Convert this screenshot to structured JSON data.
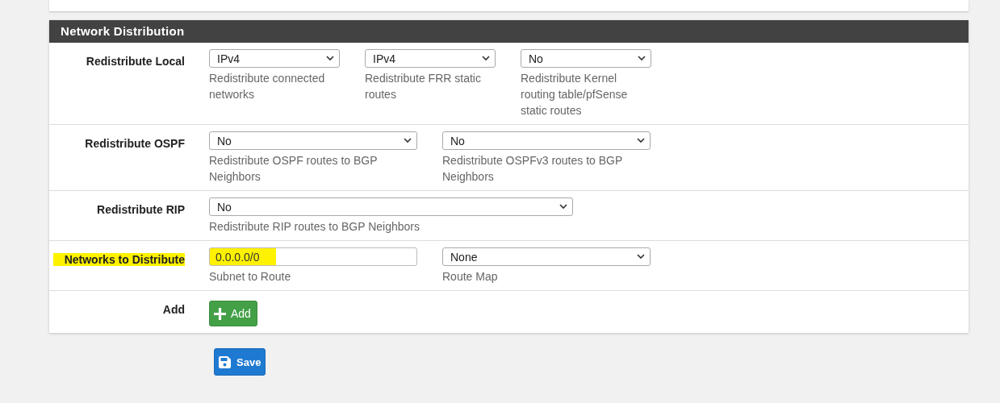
{
  "panel": {
    "title": "Network Distribution",
    "rows": [
      {
        "label": "Redistribute Local",
        "highlighted": false,
        "fields": [
          {
            "kind": "select",
            "value": "IPv4",
            "help": "Redistribute connected networks"
          },
          {
            "kind": "select",
            "value": "IPv4",
            "help": "Redistribute FRR static routes"
          },
          {
            "kind": "select",
            "value": "No",
            "help": "Redistribute Kernel routing table/pfSense static routes"
          }
        ]
      },
      {
        "label": "Redistribute OSPF",
        "highlighted": false,
        "fields": [
          {
            "kind": "select",
            "value": "No",
            "help": "Redistribute OSPF routes to BGP Neighbors"
          },
          {
            "kind": "select",
            "value": "No",
            "help": "Redistribute OSPFv3 routes to BGP Neighbors"
          }
        ]
      },
      {
        "label": "Redistribute RIP",
        "highlighted": false,
        "fields": [
          {
            "kind": "select",
            "value": "No",
            "help": "Redistribute RIP routes to BGP Neighbors"
          }
        ]
      },
      {
        "label": "Networks to Distribute",
        "highlighted": true,
        "fields": [
          {
            "kind": "input",
            "value": "0.0.0.0/0",
            "help": "Subnet to Route"
          },
          {
            "kind": "select",
            "value": "None",
            "help": "Route Map"
          }
        ]
      },
      {
        "label": "Add",
        "highlighted": false,
        "fields": [
          {
            "kind": "add-button",
            "value": "Add"
          }
        ]
      }
    ]
  },
  "save_button": "Save"
}
